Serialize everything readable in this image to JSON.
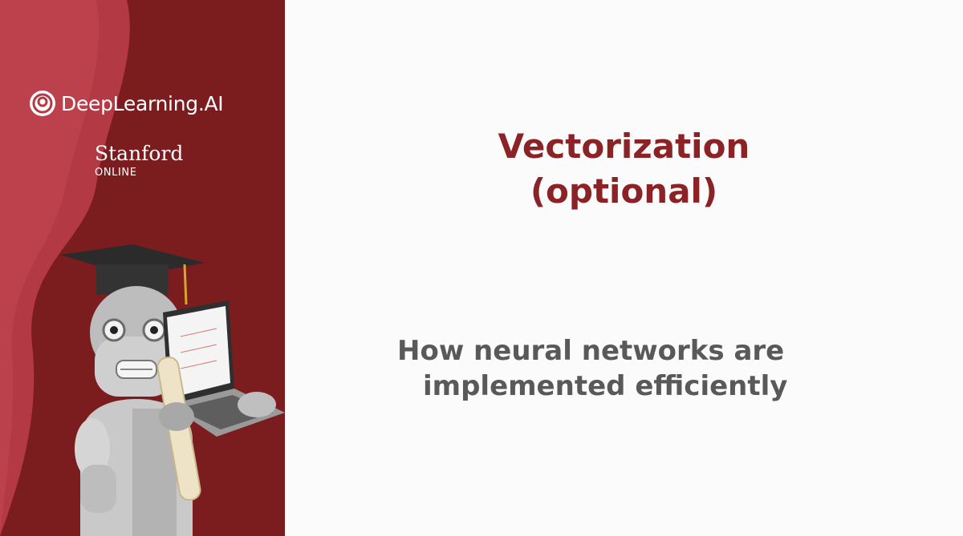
{
  "brand": {
    "name": "DeepLearning.AI",
    "partner": "Stanford",
    "partner_sub": "ONLINE"
  },
  "slide": {
    "title_line1": "Vectorization",
    "title_line2": "(optional)",
    "subtitle_line1": "How neural networks are",
    "subtitle_line2": "implemented efficiently"
  },
  "colors": {
    "sidebar": "#7b1c1f",
    "title": "#8b2326",
    "subtitle": "#595959",
    "background": "#fbfbfb"
  },
  "icons": [
    "deeplearning-logo-icon",
    "robot-mascot-icon"
  ]
}
